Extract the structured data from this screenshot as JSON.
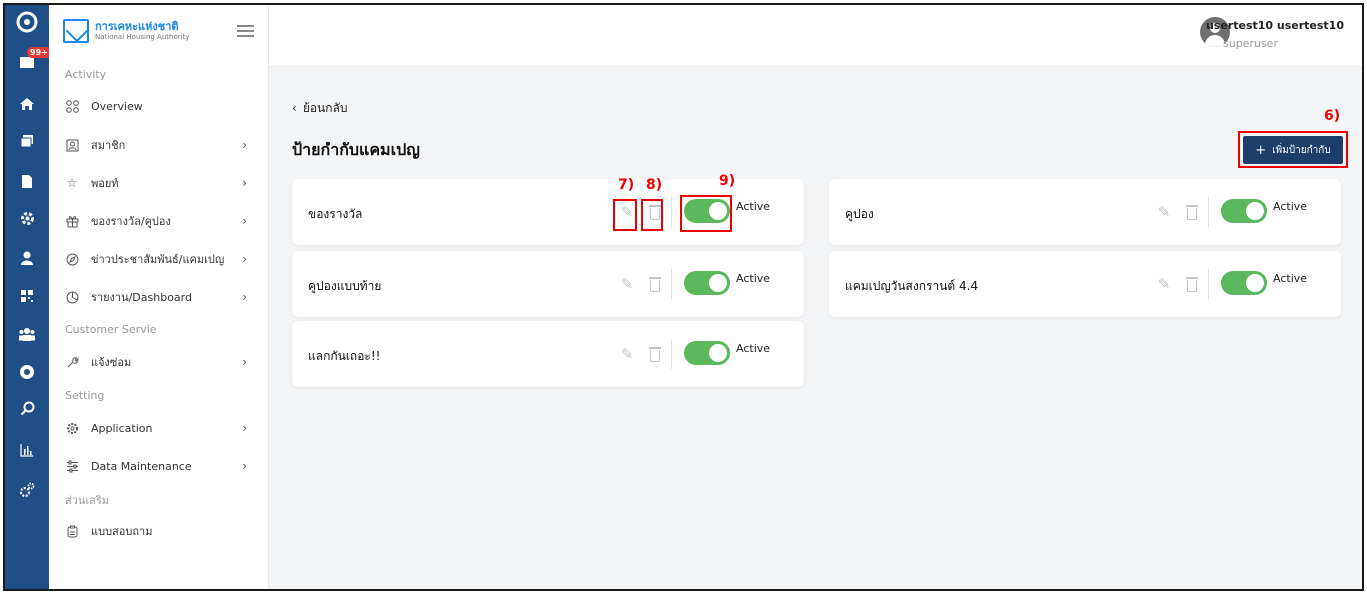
{
  "rail": {
    "badge": "99+",
    "icons": [
      "brand-c-icon",
      "inbox-icon",
      "home-icon",
      "cards-icon",
      "document-icon",
      "settings-icon",
      "user-icon",
      "grid-icon",
      "group-icon",
      "gear-circle-icon",
      "search-icon",
      "bar-chart-icon",
      "cogs-icon"
    ]
  },
  "brand": {
    "name_th": "การเคหะแห่งชาติ",
    "name_en": "National Housing Authority"
  },
  "sidebar": {
    "section_activity": "Activity",
    "section_customer": "Customer Servie",
    "section_setting": "Setting",
    "section_extra": "ส่วนเสริม",
    "items": {
      "overview": "Overview",
      "members": "สมาชิก",
      "points": "พอยท์",
      "rewards": "ของรางวัล/คูปอง",
      "news": "ข่าวประชาสัมพันธ์/แคมเปญ",
      "report": "รายงาน/Dashboard",
      "repair": "แจ้งซ่อม",
      "application": "Application",
      "data_maintenance": "Data Maintenance",
      "survey": "แบบสอบถาม"
    }
  },
  "header": {
    "user_name": "usertest10 usertest10",
    "user_role": "superuser"
  },
  "main": {
    "back_label": "ย้อนกลับ",
    "title": "ป้ายกำกับแคมเปญ",
    "add_button": "เพิ่มป้ายกำกับ",
    "annotations": {
      "add": "6)",
      "edit": "7)",
      "delete": "8)",
      "toggle": "9)"
    },
    "tags": [
      {
        "name": "ของรางวัล",
        "status": "Active"
      },
      {
        "name": "คูปองแบบท้าย",
        "status": "Active"
      },
      {
        "name": "แลกกันเถอะ!!",
        "status": "Active"
      },
      {
        "name": "คูปอง",
        "status": "Active"
      },
      {
        "name": "แคมเปญวันสงกรานต์ 4.4",
        "status": "Active"
      }
    ]
  },
  "colors": {
    "rail": "#1f4f86",
    "primary_button": "#1d3e6b",
    "toggle_on": "#5cb85c",
    "annotation": "#e00000"
  }
}
